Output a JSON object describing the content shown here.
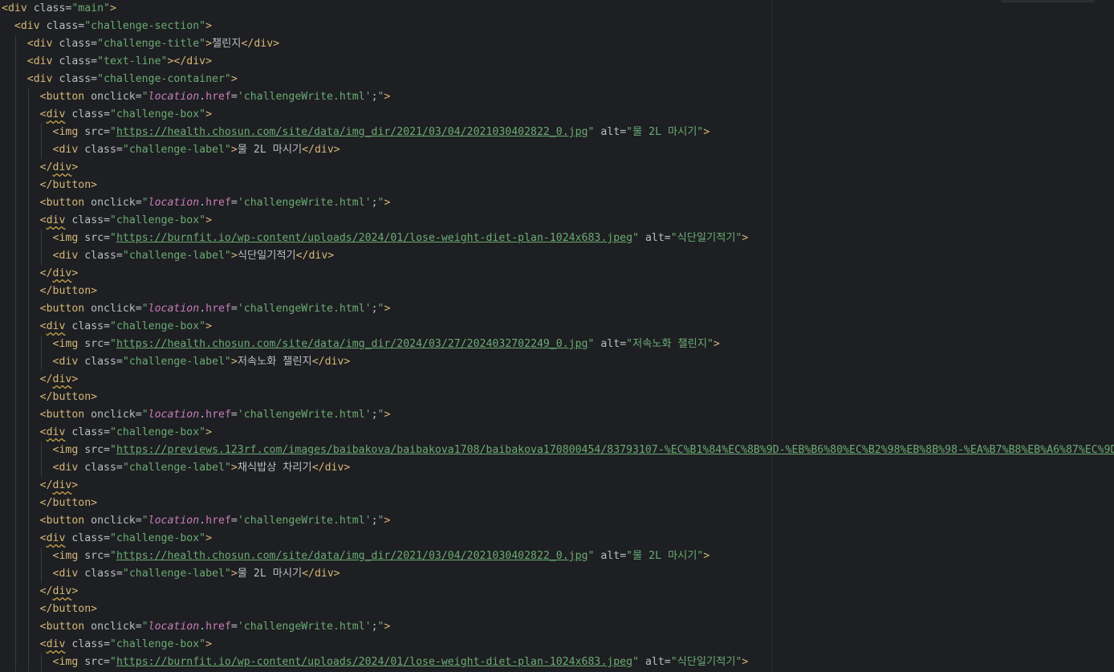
{
  "editor": {
    "lines": [
      {
        "indent": 0,
        "parts": [
          {
            "k": "tag",
            "t": "<div "
          },
          {
            "k": "attr",
            "t": "class="
          },
          {
            "k": "str",
            "t": "\"main\""
          },
          {
            "k": "tag",
            "t": ">"
          }
        ]
      },
      {
        "indent": 1,
        "parts": [
          {
            "k": "tag",
            "t": "<div "
          },
          {
            "k": "attr",
            "t": "class="
          },
          {
            "k": "str",
            "t": "\"challenge-section\""
          },
          {
            "k": "tag",
            "t": ">"
          }
        ]
      },
      {
        "indent": 2,
        "parts": [
          {
            "k": "tag",
            "t": "<div "
          },
          {
            "k": "attr",
            "t": "class="
          },
          {
            "k": "str",
            "t": "\"challenge-title\""
          },
          {
            "k": "tag",
            "t": ">"
          },
          {
            "k": "text",
            "t": "챌린지"
          },
          {
            "k": "tag",
            "t": "</div>"
          }
        ]
      },
      {
        "indent": 2,
        "parts": [
          {
            "k": "tag",
            "t": "<div "
          },
          {
            "k": "attr",
            "t": "class="
          },
          {
            "k": "str",
            "t": "\"text-line\""
          },
          {
            "k": "tag",
            "t": "></div>"
          }
        ]
      },
      {
        "indent": 2,
        "parts": [
          {
            "k": "tag",
            "t": "<div "
          },
          {
            "k": "attr",
            "t": "class="
          },
          {
            "k": "str",
            "t": "\"challenge-container\""
          },
          {
            "k": "tag",
            "t": ">"
          }
        ]
      },
      {
        "indent": 3,
        "parts": [
          {
            "k": "tag",
            "t": "<button "
          },
          {
            "k": "attr",
            "t": "onclick="
          },
          {
            "k": "str",
            "t": "\""
          },
          {
            "k": "jsobj",
            "t": "location"
          },
          {
            "k": "text",
            "t": "."
          },
          {
            "k": "jsprop",
            "t": "href"
          },
          {
            "k": "text",
            "t": "="
          },
          {
            "k": "str",
            "t": "'challengeWrite.html'"
          },
          {
            "k": "text",
            "t": ";"
          },
          {
            "k": "str",
            "t": "\""
          },
          {
            "k": "tag",
            "t": ">"
          }
        ]
      },
      {
        "indent": 3,
        "parts": [
          {
            "k": "tag",
            "t": "<"
          },
          {
            "k": "warn",
            "t": "div"
          },
          {
            "k": "tag",
            "t": " "
          },
          {
            "k": "attr",
            "t": "class="
          },
          {
            "k": "str",
            "t": "\"challenge-box\""
          },
          {
            "k": "tag",
            "t": ">"
          }
        ]
      },
      {
        "indent": 4,
        "parts": [
          {
            "k": "tag",
            "t": "<img "
          },
          {
            "k": "attr",
            "t": "src="
          },
          {
            "k": "str",
            "t": "\""
          },
          {
            "k": "url",
            "t": "https://health.chosun.com/site/data/img_dir/2021/03/04/2021030402822_0.jpg"
          },
          {
            "k": "str",
            "t": "\""
          },
          {
            "k": "attr",
            "t": " alt="
          },
          {
            "k": "str",
            "t": "\"물 2L 마시기\""
          },
          {
            "k": "tag",
            "t": ">"
          }
        ]
      },
      {
        "indent": 4,
        "parts": [
          {
            "k": "tag",
            "t": "<div "
          },
          {
            "k": "attr",
            "t": "class="
          },
          {
            "k": "str",
            "t": "\"challenge-label\""
          },
          {
            "k": "tag",
            "t": ">"
          },
          {
            "k": "text",
            "t": "물 2L 마시기"
          },
          {
            "k": "tag",
            "t": "</div>"
          }
        ]
      },
      {
        "indent": 3,
        "parts": [
          {
            "k": "tag",
            "t": "</"
          },
          {
            "k": "warn",
            "t": "div"
          },
          {
            "k": "tag",
            "t": ">"
          }
        ]
      },
      {
        "indent": 3,
        "parts": [
          {
            "k": "tag",
            "t": "</button>"
          }
        ]
      },
      {
        "indent": 3,
        "parts": [
          {
            "k": "tag",
            "t": "<button "
          },
          {
            "k": "attr",
            "t": "onclick="
          },
          {
            "k": "str",
            "t": "\""
          },
          {
            "k": "jsobj",
            "t": "location"
          },
          {
            "k": "text",
            "t": "."
          },
          {
            "k": "jsprop",
            "t": "href"
          },
          {
            "k": "text",
            "t": "="
          },
          {
            "k": "str",
            "t": "'challengeWrite.html'"
          },
          {
            "k": "text",
            "t": ";"
          },
          {
            "k": "str",
            "t": "\""
          },
          {
            "k": "tag",
            "t": ">"
          }
        ]
      },
      {
        "indent": 3,
        "parts": [
          {
            "k": "tag",
            "t": "<"
          },
          {
            "k": "warn",
            "t": "div"
          },
          {
            "k": "tag",
            "t": " "
          },
          {
            "k": "attr",
            "t": "class="
          },
          {
            "k": "str",
            "t": "\"challenge-box\""
          },
          {
            "k": "tag",
            "t": ">"
          }
        ]
      },
      {
        "indent": 4,
        "parts": [
          {
            "k": "tag",
            "t": "<img "
          },
          {
            "k": "attr",
            "t": "src="
          },
          {
            "k": "str",
            "t": "\""
          },
          {
            "k": "url",
            "t": "https://burnfit.io/wp-content/uploads/2024/01/lose-weight-diet-plan-1024x683.jpeg"
          },
          {
            "k": "str",
            "t": "\""
          },
          {
            "k": "attr",
            "t": " alt="
          },
          {
            "k": "str",
            "t": "\"식단일기적기\""
          },
          {
            "k": "tag",
            "t": ">"
          }
        ]
      },
      {
        "indent": 4,
        "parts": [
          {
            "k": "tag",
            "t": "<div "
          },
          {
            "k": "attr",
            "t": "class="
          },
          {
            "k": "str",
            "t": "\"challenge-label\""
          },
          {
            "k": "tag",
            "t": ">"
          },
          {
            "k": "text",
            "t": "식단일기적기"
          },
          {
            "k": "tag",
            "t": "</div>"
          }
        ]
      },
      {
        "indent": 3,
        "parts": [
          {
            "k": "tag",
            "t": "</"
          },
          {
            "k": "warn",
            "t": "div"
          },
          {
            "k": "tag",
            "t": ">"
          }
        ]
      },
      {
        "indent": 3,
        "parts": [
          {
            "k": "tag",
            "t": "</button>"
          }
        ]
      },
      {
        "indent": 3,
        "parts": [
          {
            "k": "tag",
            "t": "<button "
          },
          {
            "k": "attr",
            "t": "onclick="
          },
          {
            "k": "str",
            "t": "\""
          },
          {
            "k": "jsobj",
            "t": "location"
          },
          {
            "k": "text",
            "t": "."
          },
          {
            "k": "jsprop",
            "t": "href"
          },
          {
            "k": "text",
            "t": "="
          },
          {
            "k": "str",
            "t": "'challengeWrite.html'"
          },
          {
            "k": "text",
            "t": ";"
          },
          {
            "k": "str",
            "t": "\""
          },
          {
            "k": "tag",
            "t": ">"
          }
        ]
      },
      {
        "indent": 3,
        "parts": [
          {
            "k": "tag",
            "t": "<"
          },
          {
            "k": "warn",
            "t": "div"
          },
          {
            "k": "tag",
            "t": " "
          },
          {
            "k": "attr",
            "t": "class="
          },
          {
            "k": "str",
            "t": "\"challenge-box\""
          },
          {
            "k": "tag",
            "t": ">"
          }
        ]
      },
      {
        "indent": 4,
        "parts": [
          {
            "k": "tag",
            "t": "<img "
          },
          {
            "k": "attr",
            "t": "src="
          },
          {
            "k": "str",
            "t": "\""
          },
          {
            "k": "url",
            "t": "https://health.chosun.com/site/data/img_dir/2024/03/27/2024032702249_0.jpg"
          },
          {
            "k": "str",
            "t": "\""
          },
          {
            "k": "attr",
            "t": " alt="
          },
          {
            "k": "str",
            "t": "\"저속노화 챌린지\""
          },
          {
            "k": "tag",
            "t": ">"
          }
        ]
      },
      {
        "indent": 4,
        "parts": [
          {
            "k": "tag",
            "t": "<div "
          },
          {
            "k": "attr",
            "t": "class="
          },
          {
            "k": "str",
            "t": "\"challenge-label\""
          },
          {
            "k": "tag",
            "t": ">"
          },
          {
            "k": "text",
            "t": "저속노화 챌린지"
          },
          {
            "k": "tag",
            "t": "</div>"
          }
        ]
      },
      {
        "indent": 3,
        "parts": [
          {
            "k": "tag",
            "t": "</"
          },
          {
            "k": "warn",
            "t": "div"
          },
          {
            "k": "tag",
            "t": ">"
          }
        ]
      },
      {
        "indent": 3,
        "parts": [
          {
            "k": "tag",
            "t": "</button>"
          }
        ]
      },
      {
        "indent": 3,
        "parts": [
          {
            "k": "tag",
            "t": "<button "
          },
          {
            "k": "attr",
            "t": "onclick="
          },
          {
            "k": "str",
            "t": "\""
          },
          {
            "k": "jsobj",
            "t": "location"
          },
          {
            "k": "text",
            "t": "."
          },
          {
            "k": "jsprop",
            "t": "href"
          },
          {
            "k": "text",
            "t": "="
          },
          {
            "k": "str",
            "t": "'challengeWrite.html'"
          },
          {
            "k": "text",
            "t": ";"
          },
          {
            "k": "str",
            "t": "\""
          },
          {
            "k": "tag",
            "t": ">"
          }
        ]
      },
      {
        "indent": 3,
        "parts": [
          {
            "k": "tag",
            "t": "<"
          },
          {
            "k": "warn",
            "t": "div"
          },
          {
            "k": "tag",
            "t": " "
          },
          {
            "k": "attr",
            "t": "class="
          },
          {
            "k": "str",
            "t": "\"challenge-box\""
          },
          {
            "k": "tag",
            "t": ">"
          }
        ]
      },
      {
        "indent": 4,
        "parts": [
          {
            "k": "tag",
            "t": "<img "
          },
          {
            "k": "attr",
            "t": "src="
          },
          {
            "k": "str",
            "t": "\""
          },
          {
            "k": "url",
            "t": "https://previews.123rf.com/images/baibakova/baibakova1708/baibakova170800454/83793107-%EC%B1%84%EC%8B%9D-%EB%B6%80%EC%B2%98%EB%8B%98-%EA%B7%B8%EB%A6%87%EC%9D%98"
          }
        ]
      },
      {
        "indent": 4,
        "parts": [
          {
            "k": "tag",
            "t": "<div "
          },
          {
            "k": "attr",
            "t": "class="
          },
          {
            "k": "str",
            "t": "\"challenge-label\""
          },
          {
            "k": "tag",
            "t": ">"
          },
          {
            "k": "text",
            "t": "채식밥상 차리기"
          },
          {
            "k": "tag",
            "t": "</div>"
          }
        ]
      },
      {
        "indent": 3,
        "parts": [
          {
            "k": "tag",
            "t": "</"
          },
          {
            "k": "warn",
            "t": "div"
          },
          {
            "k": "tag",
            "t": ">"
          }
        ]
      },
      {
        "indent": 3,
        "parts": [
          {
            "k": "tag",
            "t": "</button>"
          }
        ]
      },
      {
        "indent": 3,
        "parts": [
          {
            "k": "tag",
            "t": "<button "
          },
          {
            "k": "attr",
            "t": "onclick="
          },
          {
            "k": "str",
            "t": "\""
          },
          {
            "k": "jsobj",
            "t": "location"
          },
          {
            "k": "text",
            "t": "."
          },
          {
            "k": "jsprop",
            "t": "href"
          },
          {
            "k": "text",
            "t": "="
          },
          {
            "k": "str",
            "t": "'challengeWrite.html'"
          },
          {
            "k": "text",
            "t": ";"
          },
          {
            "k": "str",
            "t": "\""
          },
          {
            "k": "tag",
            "t": ">"
          }
        ]
      },
      {
        "indent": 3,
        "parts": [
          {
            "k": "tag",
            "t": "<"
          },
          {
            "k": "warn",
            "t": "div"
          },
          {
            "k": "tag",
            "t": " "
          },
          {
            "k": "attr",
            "t": "class="
          },
          {
            "k": "str",
            "t": "\"challenge-box\""
          },
          {
            "k": "tag",
            "t": ">"
          }
        ]
      },
      {
        "indent": 4,
        "parts": [
          {
            "k": "tag",
            "t": "<img "
          },
          {
            "k": "attr",
            "t": "src="
          },
          {
            "k": "str",
            "t": "\""
          },
          {
            "k": "url",
            "t": "https://health.chosun.com/site/data/img_dir/2021/03/04/2021030402822_0.jpg"
          },
          {
            "k": "str",
            "t": "\""
          },
          {
            "k": "attr",
            "t": " alt="
          },
          {
            "k": "str",
            "t": "\"물 2L 마시기\""
          },
          {
            "k": "tag",
            "t": ">"
          }
        ]
      },
      {
        "indent": 4,
        "parts": [
          {
            "k": "tag",
            "t": "<div "
          },
          {
            "k": "attr",
            "t": "class="
          },
          {
            "k": "str",
            "t": "\"challenge-label\""
          },
          {
            "k": "tag",
            "t": ">"
          },
          {
            "k": "text",
            "t": "물 2L 마시기"
          },
          {
            "k": "tag",
            "t": "</div>"
          }
        ]
      },
      {
        "indent": 3,
        "parts": [
          {
            "k": "tag",
            "t": "</"
          },
          {
            "k": "warn",
            "t": "div"
          },
          {
            "k": "tag",
            "t": ">"
          }
        ]
      },
      {
        "indent": 3,
        "parts": [
          {
            "k": "tag",
            "t": "</button>"
          }
        ]
      },
      {
        "indent": 3,
        "parts": [
          {
            "k": "tag",
            "t": "<button "
          },
          {
            "k": "attr",
            "t": "onclick="
          },
          {
            "k": "str",
            "t": "\""
          },
          {
            "k": "jsobj",
            "t": "location"
          },
          {
            "k": "text",
            "t": "."
          },
          {
            "k": "jsprop",
            "t": "href"
          },
          {
            "k": "text",
            "t": "="
          },
          {
            "k": "str",
            "t": "'challengeWrite.html'"
          },
          {
            "k": "text",
            "t": ";"
          },
          {
            "k": "str",
            "t": "\""
          },
          {
            "k": "tag",
            "t": ">"
          }
        ]
      },
      {
        "indent": 3,
        "parts": [
          {
            "k": "tag",
            "t": "<"
          },
          {
            "k": "warn",
            "t": "div"
          },
          {
            "k": "tag",
            "t": " "
          },
          {
            "k": "attr",
            "t": "class="
          },
          {
            "k": "str",
            "t": "\"challenge-box\""
          },
          {
            "k": "tag",
            "t": ">"
          }
        ]
      },
      {
        "indent": 4,
        "parts": [
          {
            "k": "tag",
            "t": "<img "
          },
          {
            "k": "attr",
            "t": "src="
          },
          {
            "k": "str",
            "t": "\""
          },
          {
            "k": "url",
            "t": "https://burnfit.io/wp-content/uploads/2024/01/lose-weight-diet-plan-1024x683.jpeg"
          },
          {
            "k": "str",
            "t": "\""
          },
          {
            "k": "attr",
            "t": " alt="
          },
          {
            "k": "str",
            "t": "\"식단일기적기\""
          },
          {
            "k": "tag",
            "t": ">"
          }
        ]
      }
    ]
  },
  "colors": {
    "background": "#1e1f22",
    "tag": "#d5b778",
    "attribute": "#bcbec4",
    "string": "#6aab73",
    "js_keyword": "#c77dbb",
    "indent_guide": "#393b40"
  }
}
